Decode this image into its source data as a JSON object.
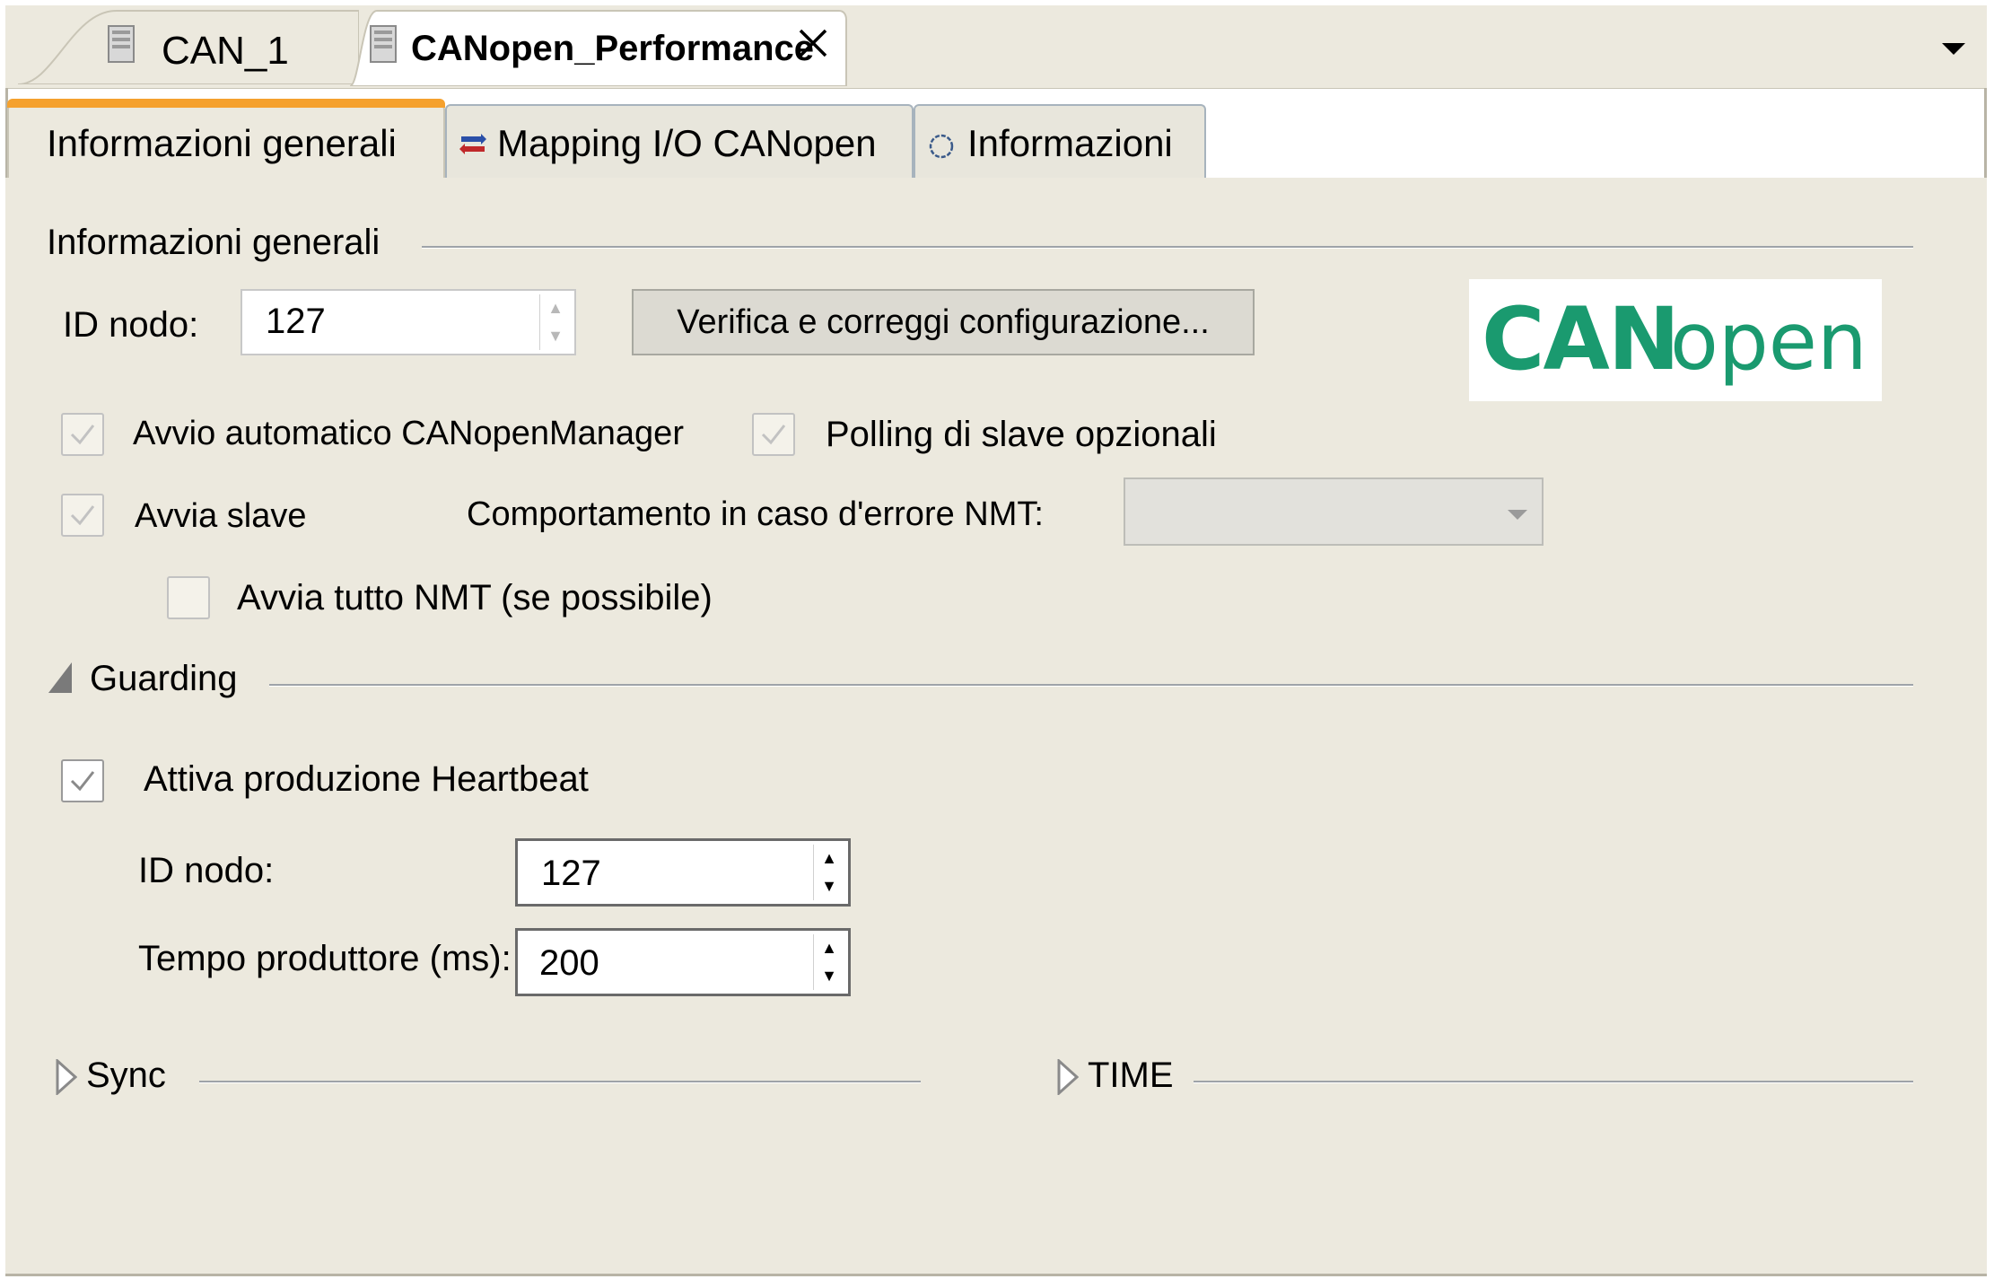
{
  "doc_tabs": [
    {
      "label": "CAN_1"
    },
    {
      "label": "CANopen_Performance"
    }
  ],
  "sub_tabs": [
    {
      "label": "Informazioni generali"
    },
    {
      "label": "Mapping I/O CANopen"
    },
    {
      "label": "Informazioni"
    }
  ],
  "general": {
    "title": "Informazioni generali",
    "node_id_label": "ID nodo:",
    "node_id_value": "127",
    "verify_button": "Verifica e correggi configurazione...",
    "logo_text_bold": "CAN",
    "logo_text_light": "open",
    "logo_color": "#1a9a6f",
    "autostart_label": "Avvio automatico CANopenManager",
    "polling_label": "Polling di slave opzionali",
    "start_slaves_label": "Avvia slave",
    "nmt_error_label": "Comportamento in caso d'errore NMT:",
    "nmt_error_value": "",
    "start_all_nmt_label": "Avvia tutto NMT (se possibile)"
  },
  "guarding": {
    "title": "Guarding",
    "heartbeat_label": "Attiva produzione Heartbeat",
    "node_id_label": "ID nodo:",
    "node_id_value": "127",
    "producer_time_label": "Tempo produttore (ms):",
    "producer_time_value": "200"
  },
  "sync": {
    "title": "Sync"
  },
  "time": {
    "title": "TIME"
  },
  "colors": {
    "panel_bg": "#ece9de",
    "active_tab_accent": "#f5a12e"
  }
}
